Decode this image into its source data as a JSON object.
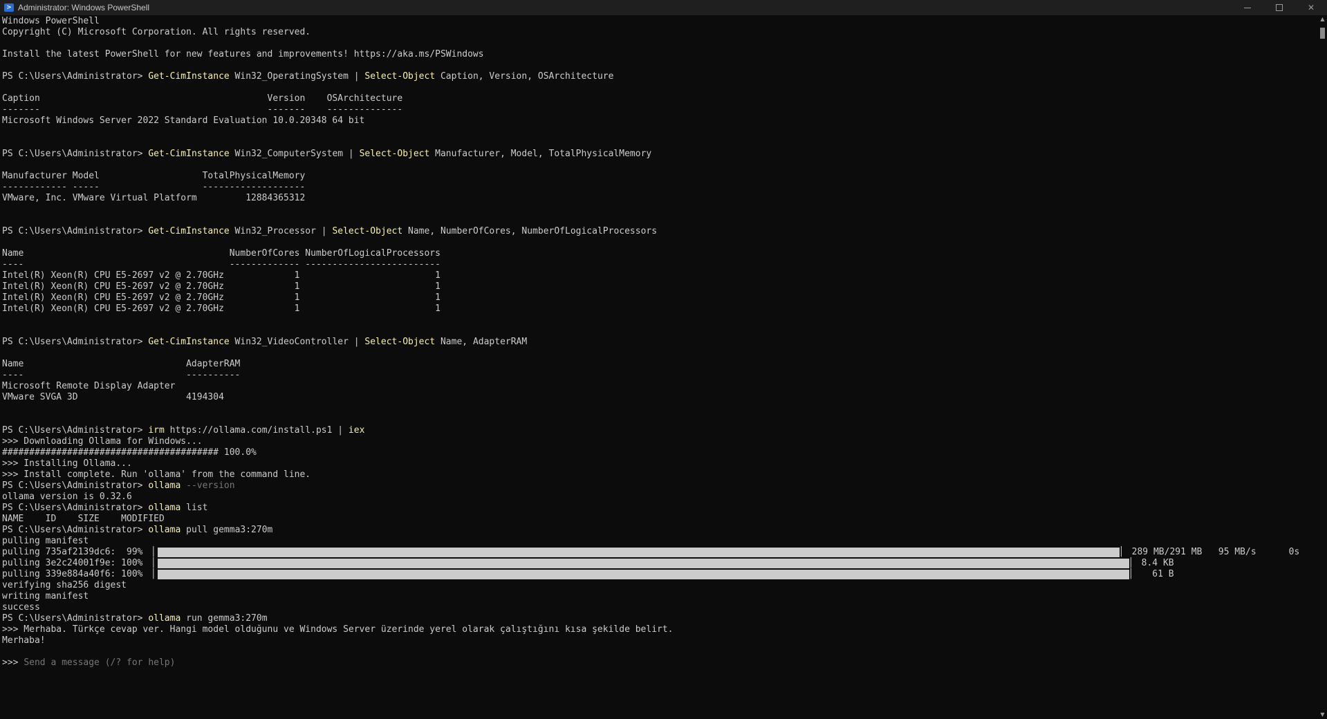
{
  "window": {
    "title": "Administrator: Windows PowerShell",
    "icon": "powershell-icon",
    "controls": [
      "minimize-icon",
      "maximize-icon",
      "close-icon"
    ],
    "close_glyph": "✕"
  },
  "terminal": {
    "header": [
      "Windows PowerShell",
      "Copyright (C) Microsoft Corporation. All rights reserved.",
      "",
      "Install the latest PowerShell for new features and improvements! https://aka.ms/PSWindows",
      ""
    ],
    "cmd1": {
      "prompt": "PS C:\\Users\\Administrator> ",
      "c1": "Get-CimInstance",
      "a1": " Win32_OperatingSystem | ",
      "c2": "Select-Object",
      "a2": " Caption, Version, OSArchitecture"
    },
    "out1": [
      "",
      "Caption                                          Version    OSArchitecture",
      "-------                                          -------    --------------",
      "Microsoft Windows Server 2022 Standard Evaluation 10.0.20348 64 bit",
      "",
      ""
    ],
    "cmd2": {
      "prompt": "PS C:\\Users\\Administrator> ",
      "c1": "Get-CimInstance",
      "a1": " Win32_ComputerSystem | ",
      "c2": "Select-Object",
      "a2": " Manufacturer, Model, TotalPhysicalMemory"
    },
    "out2": [
      "",
      "Manufacturer Model                   TotalPhysicalMemory",
      "------------ -----                   -------------------",
      "VMware, Inc. VMware Virtual Platform         12884365312",
      "",
      ""
    ],
    "cmd3": {
      "prompt": "PS C:\\Users\\Administrator> ",
      "c1": "Get-CimInstance",
      "a1": " Win32_Processor | ",
      "c2": "Select-Object",
      "a2": " Name, NumberOfCores, NumberOfLogicalProcessors"
    },
    "out3": [
      "",
      "Name                                      NumberOfCores NumberOfLogicalProcessors",
      "----                                      ------------- -------------------------",
      "Intel(R) Xeon(R) CPU E5-2697 v2 @ 2.70GHz             1                         1",
      "Intel(R) Xeon(R) CPU E5-2697 v2 @ 2.70GHz             1                         1",
      "Intel(R) Xeon(R) CPU E5-2697 v2 @ 2.70GHz             1                         1",
      "Intel(R) Xeon(R) CPU E5-2697 v2 @ 2.70GHz             1                         1",
      "",
      ""
    ],
    "cmd4": {
      "prompt": "PS C:\\Users\\Administrator> ",
      "c1": "Get-CimInstance",
      "a1": " Win32_VideoController | ",
      "c2": "Select-Object",
      "a2": " Name, AdapterRAM"
    },
    "out4": [
      "",
      "Name                              AdapterRAM",
      "----                              ----------",
      "Microsoft Remote Display Adapter",
      "VMware SVGA 3D                    4194304",
      "",
      ""
    ],
    "cmd5": {
      "prompt": "PS C:\\Users\\Administrator> ",
      "c1": "irm",
      "a1": " https://ollama.com/install.ps1 | ",
      "c2": "iex",
      "a2": ""
    },
    "out5": [
      ">>> Downloading Ollama for Windows...",
      "######################################## 100.0%",
      ">>> Installing Ollama...",
      ">>> Install complete. Run 'ollama' from the command line."
    ],
    "cmd6": {
      "prompt": "PS C:\\Users\\Administrator> ",
      "c1": "ollama",
      "dim": " --version"
    },
    "out6": [
      "ollama version is 0.32.6"
    ],
    "cmd7": {
      "prompt": "PS C:\\Users\\Administrator> ",
      "c1": "ollama",
      "a1": " list"
    },
    "out7": [
      "NAME    ID    SIZE    MODIFIED"
    ],
    "cmd8": {
      "prompt": "PS C:\\Users\\Administrator> ",
      "c1": "ollama",
      "a1": " pull gemma3:270m"
    },
    "out8": [
      "pulling manifest"
    ],
    "pulls": [
      {
        "label": "pulling 735af2139dc6:  99% ▕",
        "progress": 0.99,
        "stat": "▏ 289 MB/291 MB   95 MB/s      0s"
      },
      {
        "label": "pulling 3e2c24001f9e: 100% ▕",
        "progress": 1.0,
        "stat": "▏ 8.4 KB"
      },
      {
        "label": "pulling 339e884a40f6: 100% ▕",
        "progress": 1.0,
        "stat": "▏   61 B"
      }
    ],
    "out9": [
      "verifying sha256 digest",
      "writing manifest",
      "success"
    ],
    "cmd9": {
      "prompt": "PS C:\\Users\\Administrator> ",
      "c1": "ollama",
      "a1": " run gemma3:270m"
    },
    "out10": [
      ">>> Merhaba. Türkçe cevap ver. Hangi model olduğunu ve Windows Server üzerinde yerel olarak çalıştığını kısa şekilde belirt.",
      "Merhaba!",
      ""
    ],
    "input_prompt": ">>> ",
    "input_placeholder": "Send a message (/? for help)"
  },
  "colors": {
    "background": "#0c0c0c",
    "text": "#cccccc",
    "command": "#f9f1a5",
    "dim": "#767676",
    "progress_bar": "#cccccc"
  }
}
